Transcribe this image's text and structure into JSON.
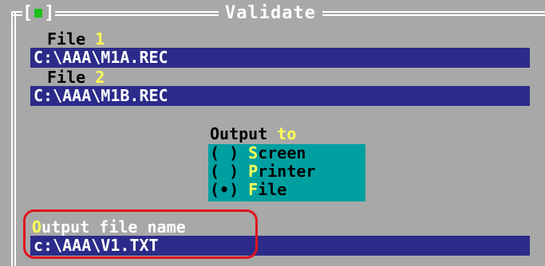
{
  "window": {
    "title": "Validate",
    "close_glyph": "[■]"
  },
  "file1": {
    "label": "File",
    "hotkey": "1",
    "value": "C:\\AAA\\M1A.REC"
  },
  "file2": {
    "label": "File",
    "hotkey": "2",
    "value": "C:\\AAA\\M1B.REC"
  },
  "output_to": {
    "label": "Output",
    "hot_label": "to",
    "options": [
      {
        "mark": "( )",
        "hotkey": "S",
        "rest": "creen",
        "selected": false
      },
      {
        "mark": "( )",
        "hotkey": "P",
        "rest": "rinter",
        "selected": false
      },
      {
        "mark": "(•)",
        "hotkey": "F",
        "rest": "ile",
        "selected": true
      }
    ]
  },
  "output_file": {
    "hotkey": "O",
    "label_rest": "utput file name",
    "value": "c:\\AAA\\V1.TXT"
  },
  "colors": {
    "background": "#a8a8a8",
    "field": "#2b2b8a",
    "radio_group": "#00a0a0",
    "hotkey": "#ffff55",
    "annotation": "#e0141e"
  }
}
